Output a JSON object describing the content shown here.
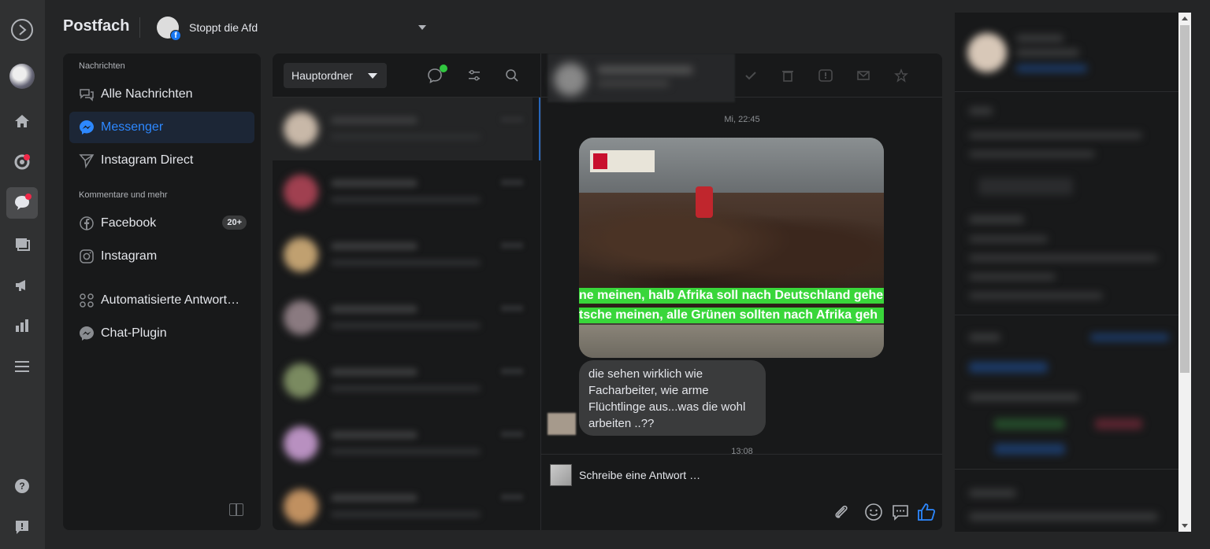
{
  "header": {
    "title": "Postfach",
    "page_name": "Stoppt die Afd"
  },
  "nav": {
    "section_messages": "Nachrichten",
    "section_comments": "Kommentare und mehr",
    "items": [
      {
        "label": "Alle Nachrichten",
        "icon": "chat-bubbles-icon"
      },
      {
        "label": "Messenger",
        "icon": "messenger-icon",
        "selected": true
      },
      {
        "label": "Instagram Direct",
        "icon": "send-icon"
      },
      {
        "label": "Facebook",
        "icon": "facebook-icon",
        "badge": "20+"
      },
      {
        "label": "Instagram",
        "icon": "instagram-icon"
      },
      {
        "label": "Automatisierte Antwort…",
        "icon": "automation-icon"
      },
      {
        "label": "Chat-Plugin",
        "icon": "messenger-icon"
      }
    ]
  },
  "list": {
    "folder": "Hauptordner"
  },
  "chat": {
    "timestamp_1": "Mi, 22:45",
    "image_caption_line1": "ne meinen, halb Afrika soll nach Deutschland gehe",
    "image_caption_line2": "tsche meinen, alle Grünen sollten nach Afrika geh",
    "message_line1": "die sehen wirklich wie",
    "message_line2": "Facharbeiter, wie arme",
    "message_line3": "Flüchtlinge aus...was die wohl",
    "message_line4": "arbeiten ..??",
    "timestamp_2": "13:08",
    "composer_placeholder": "Schreibe eine Antwort …"
  },
  "colors": {
    "accent": "#2d88ff",
    "banner_green": "#39d63a",
    "notification": "#f02849",
    "online": "#31c740"
  }
}
